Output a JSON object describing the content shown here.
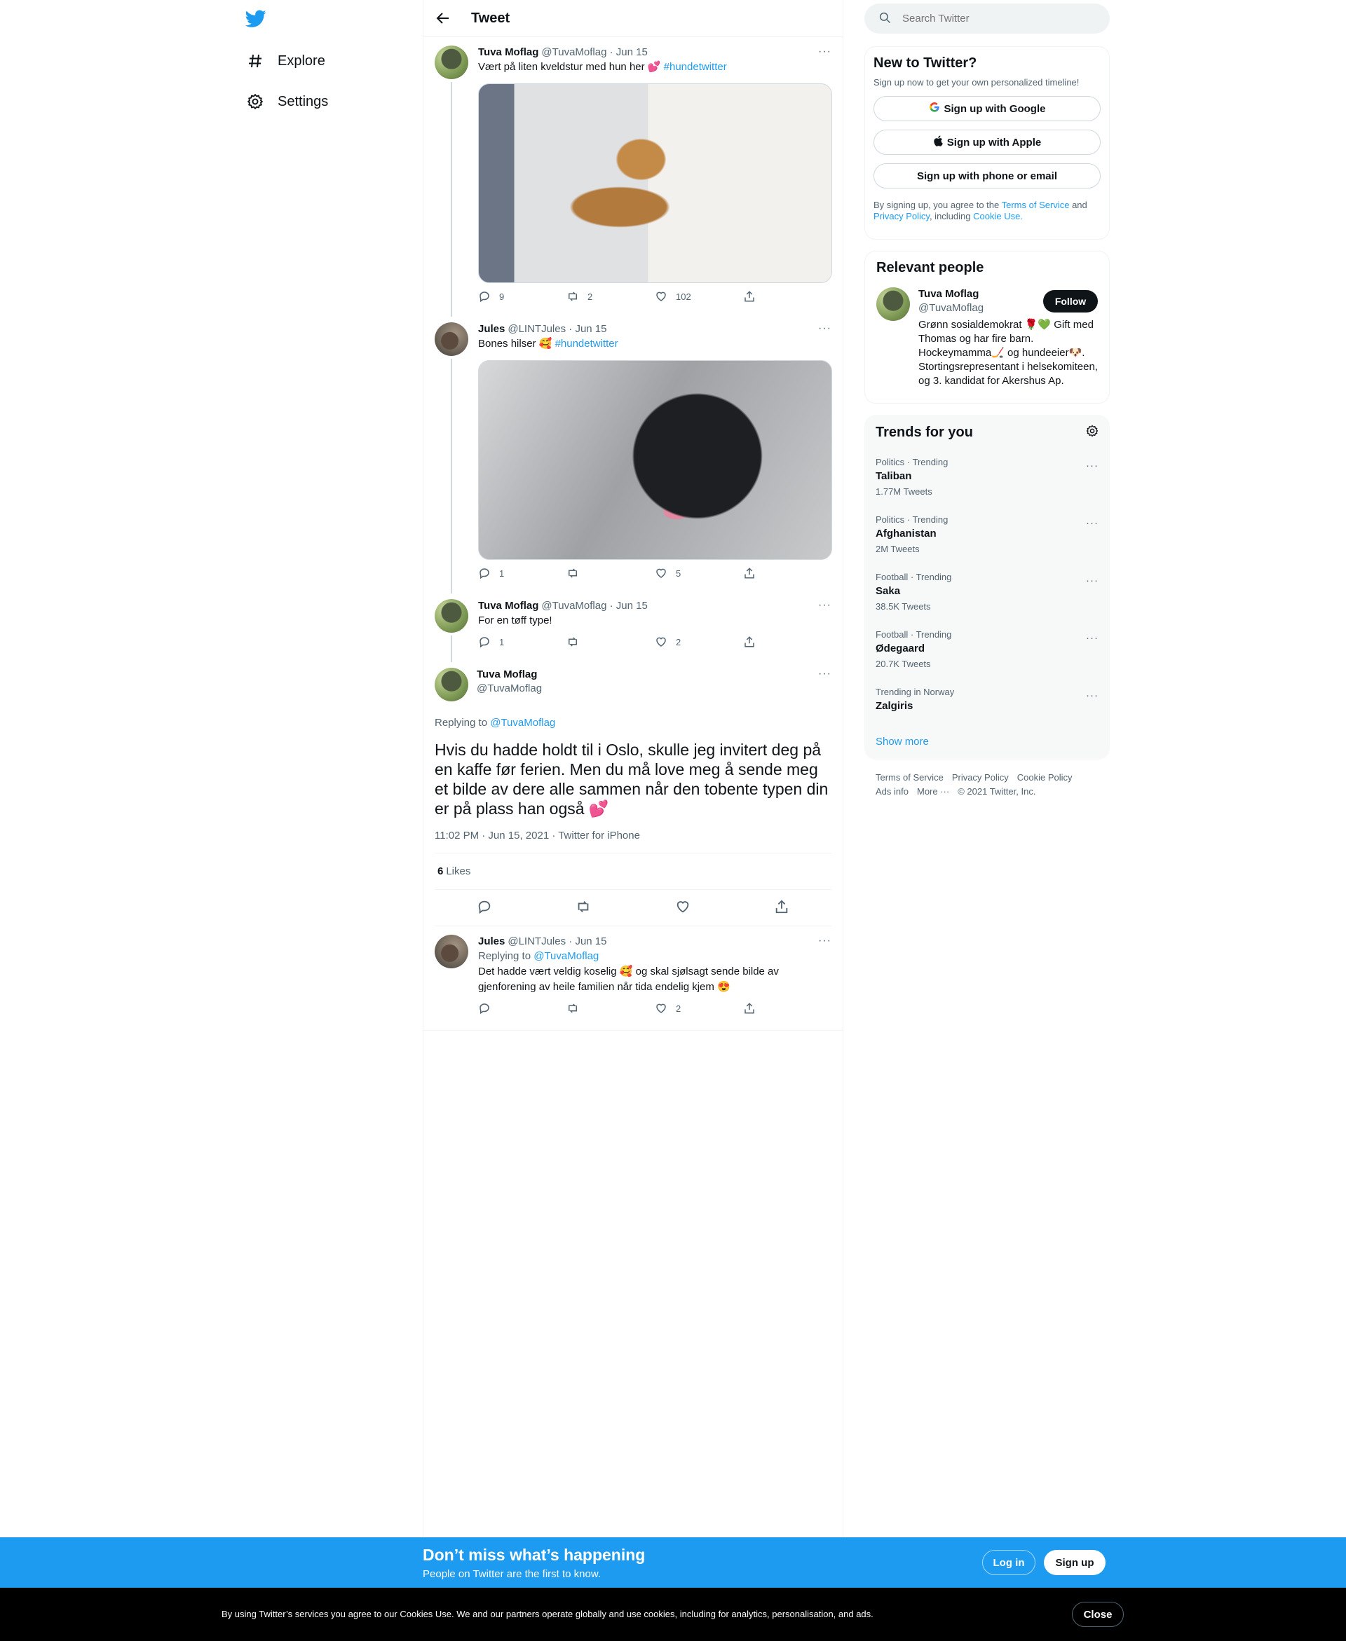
{
  "colors": {
    "accent": "#1d9bf0",
    "text": "#0f1419",
    "muted": "#536471",
    "border": "#eff3f4",
    "heart": "#f91880"
  },
  "nav": {
    "logo_icon": "twitter-bird-icon",
    "items": [
      {
        "label": "Explore",
        "icon": "hashtag-icon"
      },
      {
        "label": "Settings",
        "icon": "gear-icon"
      }
    ]
  },
  "header": {
    "title": "Tweet",
    "back_icon": "back-arrow-icon"
  },
  "thread": [
    {
      "name": "Tuva Moflag",
      "handle": "@TuvaMoflag",
      "date": "· Jun 15",
      "text": "Vært på liten kveldstur med hun her 💕",
      "hashtag": "#hundetwitter",
      "replies": "9",
      "retweets": "2",
      "likes": "102"
    },
    {
      "name": "Jules",
      "handle": "@LINTJules",
      "date": "· Jun 15",
      "text": "Bones hilser 🥰",
      "hashtag": "#hundetwitter",
      "replies": "1",
      "retweets": "",
      "likes": "5"
    },
    {
      "name": "Tuva Moflag",
      "handle": "@TuvaMoflag",
      "date": "· Jun 15",
      "text": "For en tøff type!",
      "hashtag": "",
      "replies": "1",
      "retweets": "",
      "likes": "2"
    }
  ],
  "focal": {
    "name": "Tuva Moflag",
    "handle": "@TuvaMoflag",
    "replying_prefix": "Replying to",
    "replying_to": "@TuvaMoflag",
    "text": "Hvis du hadde holdt til i Oslo, skulle jeg invitert deg på en kaffe før ferien. Men du må love meg å sende meg et bilde av dere alle sammen når den tobente typen din er på plass han også 💕",
    "timestamp": "11:02 PM · Jun 15, 2021 · Twitter for iPhone",
    "likes_count": "6",
    "likes_label": "Likes"
  },
  "reply": {
    "name": "Jules",
    "handle": "@LINTJules",
    "date": "· Jun 15",
    "replying_prefix": "Replying to",
    "replying_to": "@TuvaMoflag",
    "text": "Det hadde vært veldig koselig 🥰 og skal sjølsagt sende bilde av gjenforening av heile familien når tida endelig kjem 😍",
    "replies": "",
    "retweets": "",
    "likes": "2"
  },
  "search": {
    "placeholder": "Search Twitter"
  },
  "signup": {
    "title": "New to Twitter?",
    "subtitle": "Sign up now to get your own personalized timeline!",
    "google": "Sign up with Google",
    "apple": "Sign up with Apple",
    "phone": "Sign up with phone or email",
    "legal_1": "By signing up, you agree to the",
    "terms": "Terms of Service",
    "and": "and",
    "privacy": "Privacy Policy",
    "including": ", including",
    "cookie": "Cookie Use."
  },
  "relevant": {
    "title": "Relevant people",
    "name": "Tuva Moflag",
    "handle": "@TuvaMoflag",
    "follow": "Follow",
    "bio": "Grønn sosialdemokrat 🌹💚 Gift med Thomas og har fire barn. Hockeymamma🏒 og hundeeier🐶. Stortingsrepresentant i helsekomiteen, og 3. kandidat for Akershus Ap."
  },
  "trends": {
    "title": "Trends for you",
    "items": [
      {
        "category": "Politics · Trending",
        "name": "Taliban",
        "count": "1.77M Tweets"
      },
      {
        "category": "Politics · Trending",
        "name": "Afghanistan",
        "count": "2M Tweets"
      },
      {
        "category": "Football · Trending",
        "name": "Saka",
        "count": "38.5K Tweets"
      },
      {
        "category": "Football · Trending",
        "name": "Ødegaard",
        "count": "20.7K Tweets"
      },
      {
        "category": "Trending in Norway",
        "name": "Zalgiris",
        "count": ""
      }
    ],
    "show_more": "Show more"
  },
  "footer": {
    "terms": "Terms of Service",
    "privacy": "Privacy Policy",
    "cookie": "Cookie Policy",
    "ads": "Ads info",
    "more": "More ···",
    "copyright": "© 2021 Twitter, Inc."
  },
  "banner": {
    "title": "Don’t miss what’s happening",
    "subtitle": "People on Twitter are the first to know.",
    "login": "Log in",
    "signup": "Sign up"
  },
  "cookie_bar": {
    "message": "By using Twitter’s services you agree to our Cookies Use. We and our partners operate globally and use cookies, including for analytics, personalisation, and ads.",
    "close": "Close"
  }
}
